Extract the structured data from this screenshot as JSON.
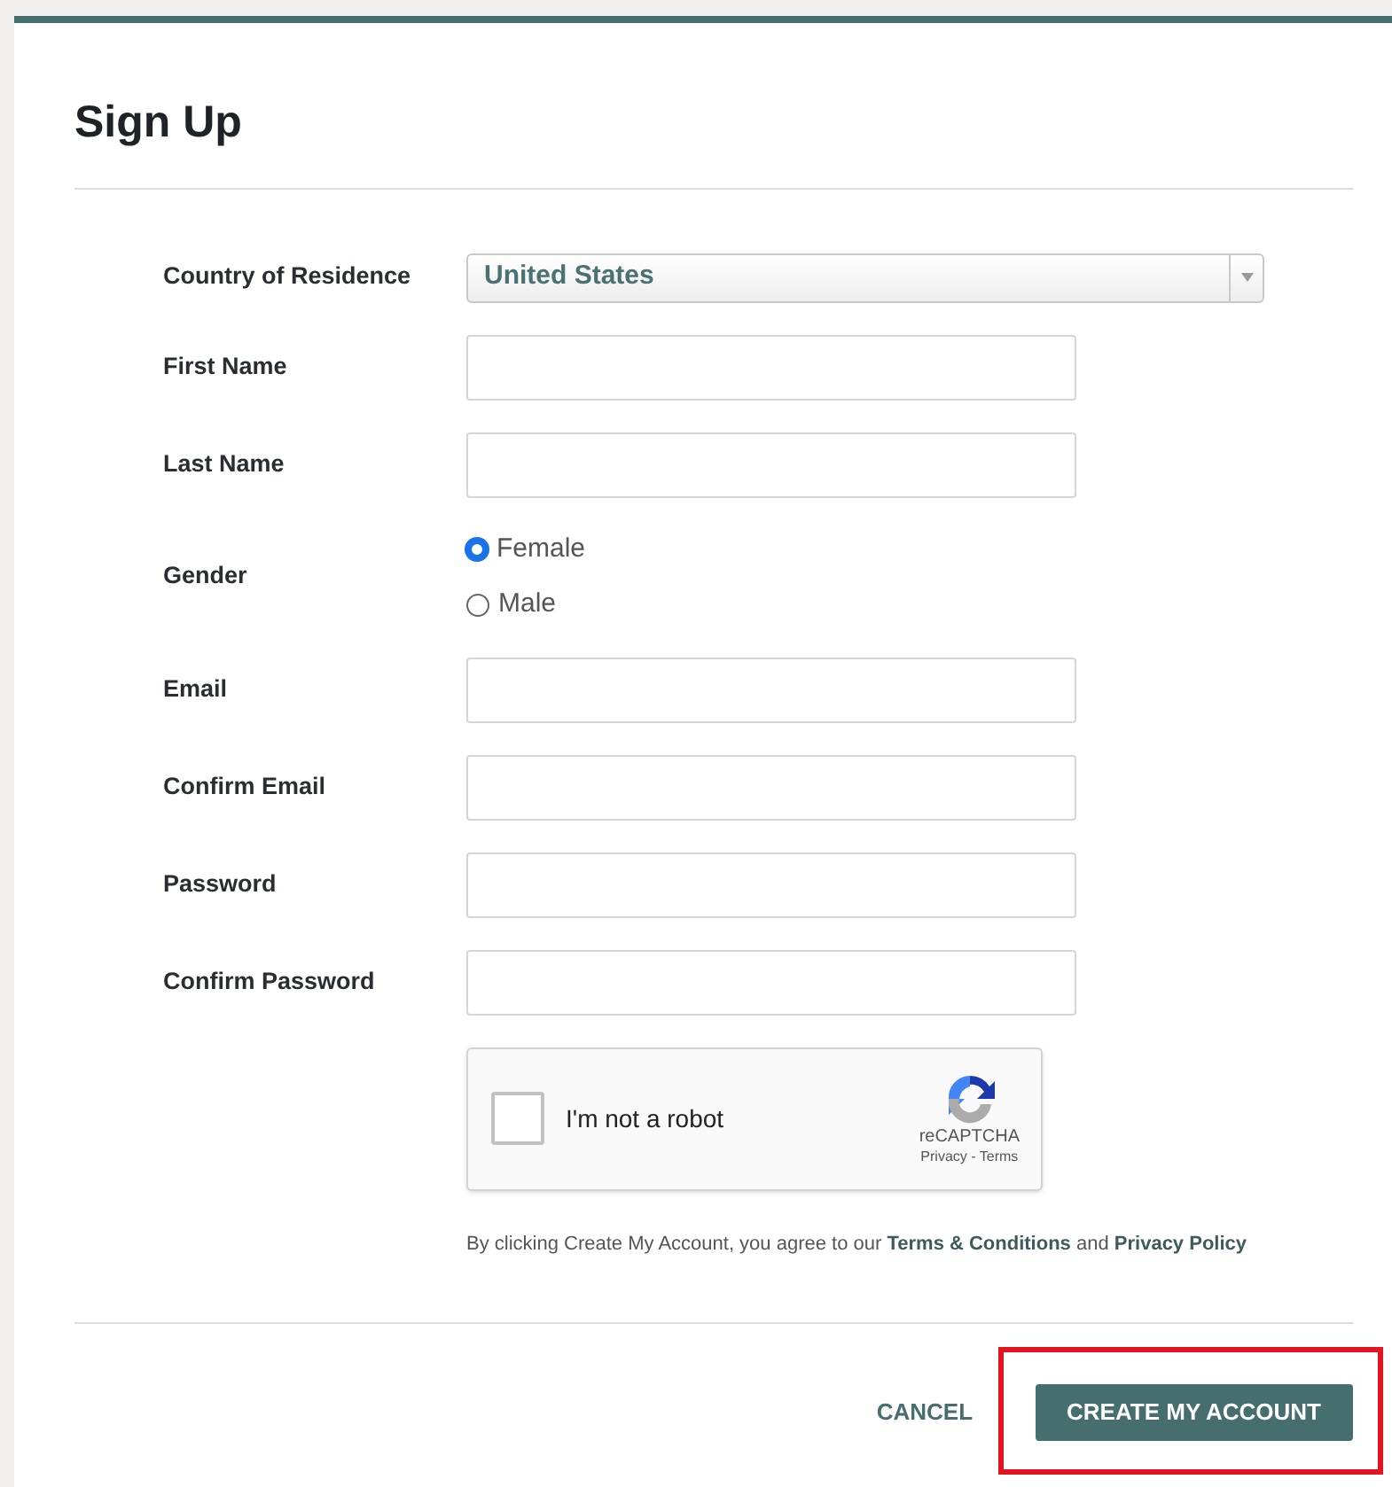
{
  "title": "Sign Up",
  "fields": [
    {
      "kind": "select",
      "label": "Country of Residence",
      "value": "United States"
    },
    {
      "kind": "text",
      "label": "First Name"
    },
    {
      "kind": "text",
      "label": "Last Name"
    },
    {
      "kind": "radio",
      "label": "Gender",
      "options": [
        {
          "label": "Female",
          "selected": true
        },
        {
          "label": "Male",
          "selected": false
        }
      ]
    },
    {
      "kind": "text",
      "label": "Email"
    },
    {
      "kind": "text",
      "label": "Confirm Email"
    },
    {
      "kind": "text",
      "label": "Password"
    },
    {
      "kind": "text",
      "label": "Confirm Password"
    }
  ],
  "captcha": {
    "label": "I'm not a robot",
    "checked": false,
    "brand": "reCAPTCHA",
    "links": "Privacy - Terms"
  },
  "notice": [
    {
      "kind": "text",
      "text": "By clicking Create My Account, you agree to our "
    },
    {
      "kind": "link",
      "text": "Terms & Conditions"
    },
    {
      "kind": "text",
      "text": " and "
    },
    {
      "kind": "link",
      "text": "Privacy Policy"
    }
  ],
  "buttons": [
    {
      "kind": "secondary",
      "label": "CANCEL",
      "highlighted": false
    },
    {
      "kind": "primary",
      "label": "CREATE MY ACCOUNT",
      "highlighted": true
    }
  ]
}
